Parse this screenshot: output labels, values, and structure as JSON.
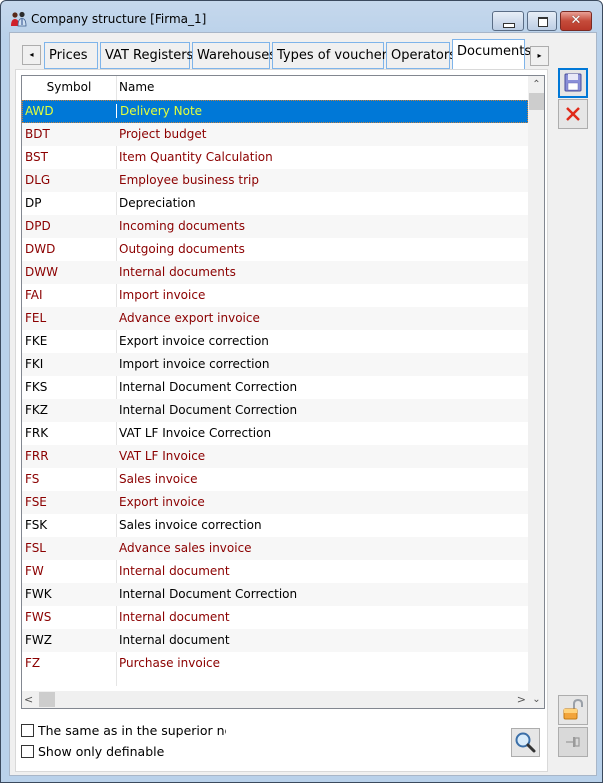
{
  "window": {
    "title": "Company structure [Firma_1]",
    "icon": "users-icon",
    "controls": {
      "minimize": "minimize-icon",
      "maximize": "maximize-icon",
      "close": "✕"
    }
  },
  "tabs": {
    "scroll_left": "◂",
    "scroll_right": "▸",
    "items": [
      {
        "label": "Prices",
        "active": false
      },
      {
        "label": "VAT Registers",
        "active": false
      },
      {
        "label": "Warehouses",
        "active": false
      },
      {
        "label": "Types of vouchers",
        "active": false
      },
      {
        "label": "Operators",
        "active": false
      },
      {
        "label": "Documents",
        "active": true
      }
    ]
  },
  "grid": {
    "columns": [
      "Symbol",
      "Name"
    ],
    "selected_index": 0,
    "colors": {
      "defined": "#8b0000",
      "undefined": "#000000",
      "selected_bg": "#0078d7",
      "selected_text": "#e2ff3c"
    },
    "rows": [
      {
        "symbol": "AWD",
        "name": "Delivery Note",
        "color": "red"
      },
      {
        "symbol": "BDT",
        "name": "Project budget",
        "color": "red"
      },
      {
        "symbol": "BST",
        "name": "Item Quantity Calculation",
        "color": "red"
      },
      {
        "symbol": "DLG",
        "name": "Employee business trip",
        "color": "red"
      },
      {
        "symbol": "DP",
        "name": "Depreciation",
        "color": "black"
      },
      {
        "symbol": "DPD",
        "name": "Incoming documents",
        "color": "red"
      },
      {
        "symbol": "DWD",
        "name": "Outgoing documents",
        "color": "red"
      },
      {
        "symbol": "DWW",
        "name": "Internal documents",
        "color": "red"
      },
      {
        "symbol": "FAI",
        "name": "Import invoice",
        "color": "red"
      },
      {
        "symbol": "FEL",
        "name": "Advance export invoice",
        "color": "red"
      },
      {
        "symbol": "FKE",
        "name": "Export invoice correction",
        "color": "black"
      },
      {
        "symbol": "FKI",
        "name": "Import invoice correction",
        "color": "black"
      },
      {
        "symbol": "FKS",
        "name": "Internal Document Correction",
        "color": "black"
      },
      {
        "symbol": "FKZ",
        "name": "Internal Document Correction",
        "color": "black"
      },
      {
        "symbol": "FRK",
        "name": "VAT LF Invoice Correction",
        "color": "black"
      },
      {
        "symbol": "FRR",
        "name": "VAT LF Invoice",
        "color": "red"
      },
      {
        "symbol": "FS",
        "name": "Sales invoice",
        "color": "red"
      },
      {
        "symbol": "FSE",
        "name": "Export invoice",
        "color": "red"
      },
      {
        "symbol": "FSK",
        "name": "Sales invoice correction",
        "color": "black"
      },
      {
        "symbol": "FSL",
        "name": "Advance sales invoice",
        "color": "red"
      },
      {
        "symbol": "FW",
        "name": "Internal document",
        "color": "red"
      },
      {
        "symbol": "FWK",
        "name": "Internal Document Correction",
        "color": "black"
      },
      {
        "symbol": "FWS",
        "name": "Internal document",
        "color": "red"
      },
      {
        "symbol": "FWZ",
        "name": "Internal document",
        "color": "black"
      },
      {
        "symbol": "FZ",
        "name": "Purchase invoice",
        "color": "red"
      }
    ],
    "scroll": {
      "up": "⌃",
      "down": "⌄",
      "left": "<",
      "right": ">"
    }
  },
  "options": {
    "same_as_superior": {
      "label": "The same as in the superior noc",
      "checked": false
    },
    "show_only_definable": {
      "label": "Show only definable",
      "checked": false
    }
  },
  "buttons": {
    "save": "save-icon",
    "cancel": "cancel-icon",
    "search": "search-icon",
    "unlock": "unlock-icon",
    "pin": "pin-icon"
  }
}
